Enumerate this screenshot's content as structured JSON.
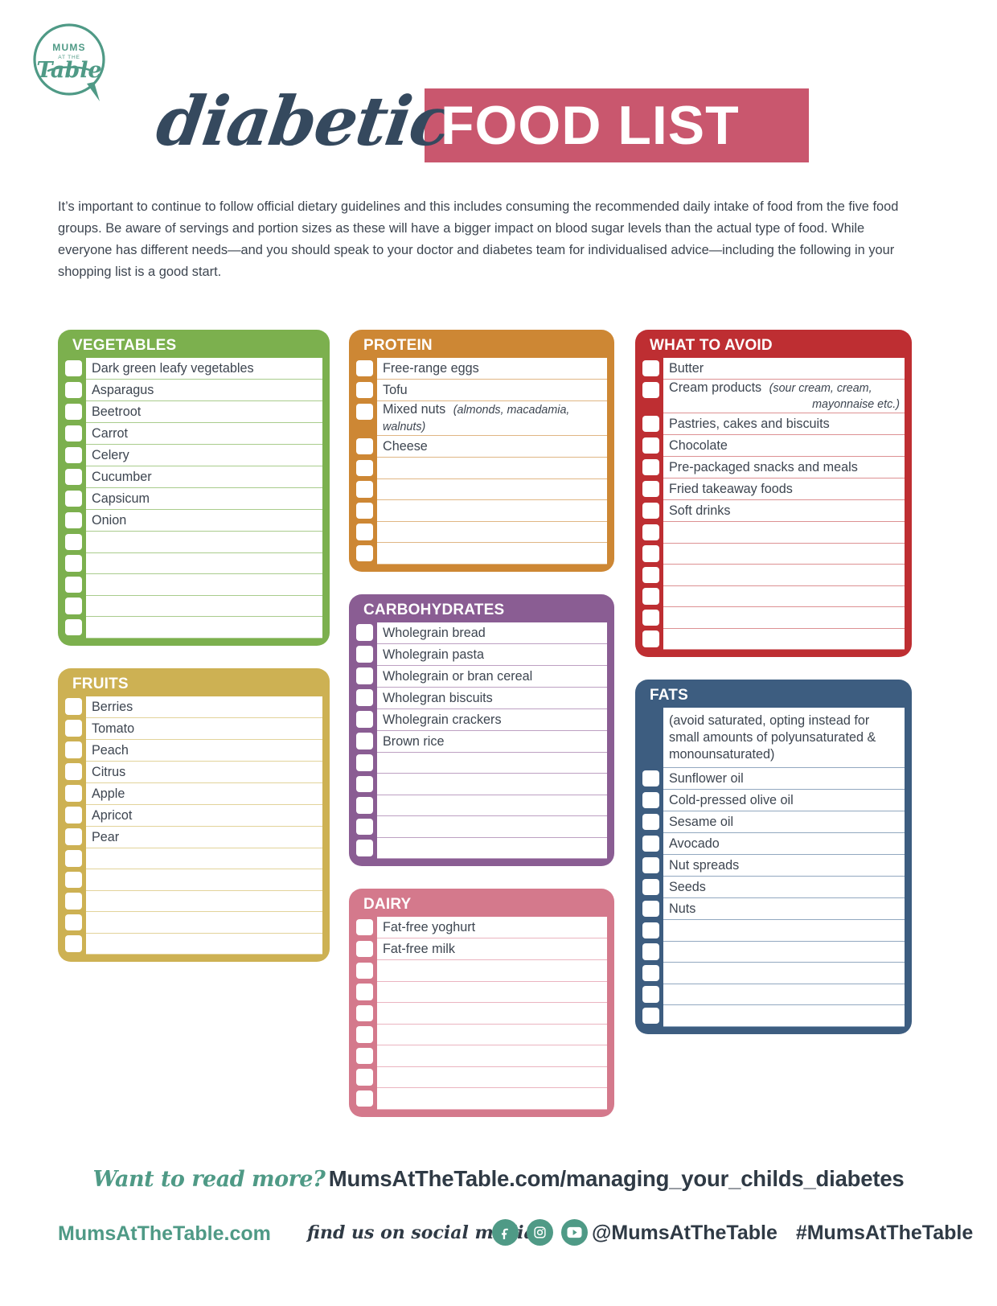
{
  "brand": {
    "logo_line1": "MUMS",
    "logo_line2": "AT THE",
    "logo_line3": "Table"
  },
  "header": {
    "title_script": "diabetic",
    "title_block": "FOOD LIST",
    "accent_color": "#c9576e",
    "script_color": "#35495e"
  },
  "intro": {
    "paragraph": "It’s important to continue to follow official dietary guidelines and this includes consuming the recommended daily intake of food from the five food groups. Be aware of servings and portion sizes as these will have a bigger impact on blood sugar levels than the actual type of food. While everyone has different needs—and you should speak to your doctor and diabetes team for individualised advice—including the following in your shopping list is a good start."
  },
  "columns": [
    {
      "cards": [
        {
          "title": "VEGETABLES",
          "color": "#7cb04e",
          "items": [
            "Dark green leafy vegetables",
            "Asparagus",
            "Beetroot",
            "Carrot",
            "Celery",
            "Cucumber",
            "Capsicum",
            "Onion"
          ],
          "blank_rows": 5
        },
        {
          "title": "FRUITS",
          "color": "#cdb153",
          "items": [
            "Berries",
            "Tomato",
            "Peach",
            "Citrus",
            "Apple",
            "Apricot",
            "Pear"
          ],
          "blank_rows": 5
        }
      ]
    },
    {
      "cards": [
        {
          "title": "PROTEIN",
          "color": "#cd8734",
          "items": [
            "Free-range eggs",
            "Tofu",
            "Mixed nuts",
            "Cheese"
          ],
          "item_notes": {
            "2": "(almonds, macadamia, walnuts)"
          },
          "blank_rows": 5
        },
        {
          "title": "CARBOHYDRATES",
          "color": "#8a5d93",
          "items": [
            "Wholegrain bread",
            "Wholegrain pasta",
            "Wholegrain or bran cereal",
            "Wholegran biscuits",
            "Wholegrain crackers",
            "Brown rice"
          ],
          "blank_rows": 5
        },
        {
          "title": "DAIRY",
          "color": "#d4798c",
          "items": [
            "Fat-free yoghurt",
            "Fat-free milk"
          ],
          "blank_rows": 7
        }
      ]
    },
    {
      "cards": [
        {
          "title": "WHAT TO AVOID",
          "color": "#be2e32",
          "items": [
            "Butter",
            "Cream products",
            "Pastries, cakes and biscuits",
            "Chocolate",
            "Pre-packaged snacks and meals",
            "Fried takeaway foods",
            "Soft drinks"
          ],
          "item_notes": {
            "1": "(sour cream, cream, mayonnaise etc.)"
          },
          "blank_rows": 6
        },
        {
          "title": "FATS",
          "color": "#3d5d80",
          "note": "(avoid saturated, opting instead for small amounts of polyunsaturated & monounsaturated)",
          "items": [
            "Sunflower oil",
            "Cold-pressed olive oil",
            "Sesame oil",
            "Avocado",
            "Nut spreads",
            "Seeds",
            "Nuts"
          ],
          "blank_rows": 5
        }
      ]
    }
  ],
  "footer": {
    "read_more_script": "Want to read more?",
    "read_more_url": "MumsAtTheTable.com/managing_your_childs_diabetes",
    "brand_site": "MumsAtTheTable.com",
    "find_us": "find us on social media",
    "social_icons": [
      "facebook-icon",
      "instagram-icon",
      "youtube-icon"
    ],
    "handle": "@MumsAtTheTable",
    "hashtag": "#MumsAtTheTable"
  }
}
